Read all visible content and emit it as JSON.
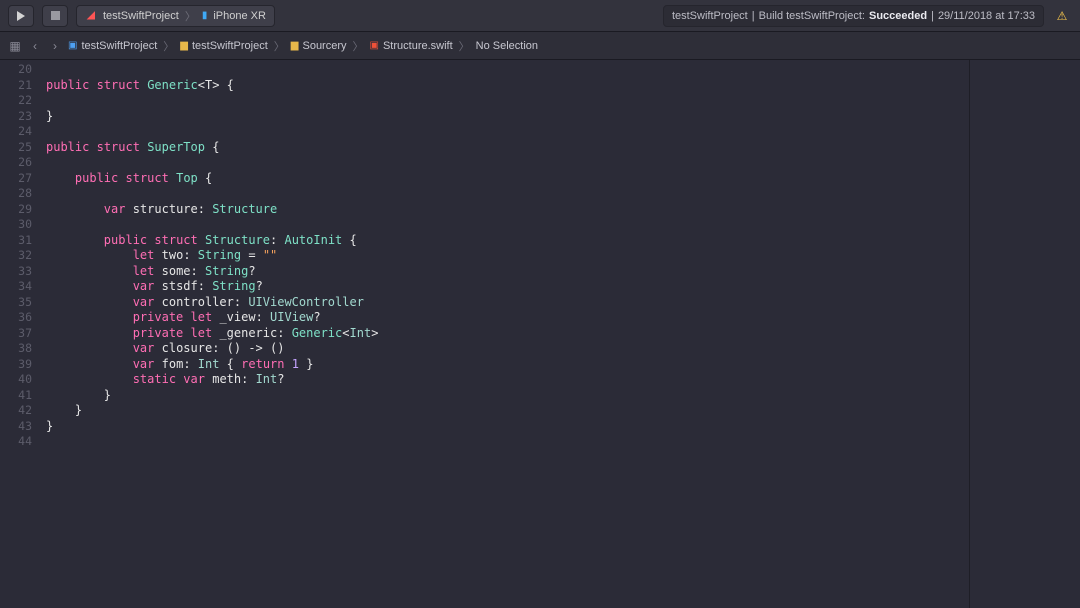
{
  "toolbar": {
    "scheme_project": "testSwiftProject",
    "scheme_device": "iPhone XR"
  },
  "status": {
    "project": "testSwiftProject",
    "action": "Build testSwiftProject:",
    "result": "Succeeded",
    "time": "29/11/2018 at 17:33"
  },
  "jumpbar": {
    "items": [
      "testSwiftProject",
      "testSwiftProject",
      "Sourcery",
      "Structure.swift",
      "No Selection"
    ]
  },
  "gutter": {
    "start": 20,
    "end": 44
  },
  "code": {
    "l20": "",
    "l21_a": "public",
    "l21_b": "struct",
    "l21_c": "Generic",
    "l21_d": "<T> {",
    "l22": "",
    "l23": "}",
    "l24": "",
    "l25_a": "public",
    "l25_b": "struct",
    "l25_c": "SuperTop",
    "l25_d": " {",
    "l26": "",
    "l27_a": "public",
    "l27_b": "struct",
    "l27_c": "Top",
    "l27_d": " {",
    "l28": "",
    "l29_a": "var",
    "l29_b": "structure",
    "l29_c": ": ",
    "l29_d": "Structure",
    "l30": "",
    "l31_a": "public",
    "l31_b": "struct",
    "l31_c": "Structure",
    "l31_d": ": ",
    "l31_e": "AutoInit",
    "l31_f": " {",
    "l32_a": "let",
    "l32_b": "two",
    "l32_c": ": ",
    "l32_d": "String",
    "l32_e": " = ",
    "l32_f": "\"\"",
    "l33_a": "let",
    "l33_b": "some",
    "l33_c": ": ",
    "l33_d": "String",
    "l33_e": "?",
    "l34_a": "var",
    "l34_b": "stsdf",
    "l34_c": ": ",
    "l34_d": "String",
    "l34_e": "?",
    "l35_a": "var",
    "l35_b": "controller",
    "l35_c": ": ",
    "l35_d": "UIViewController",
    "l36_a": "private",
    "l36_b": "let",
    "l36_c": "_view",
    "l36_d": ": ",
    "l36_e": "UIView",
    "l36_f": "?",
    "l37_a": "private",
    "l37_b": "let",
    "l37_c": "_generic",
    "l37_d": ": ",
    "l37_e": "Generic",
    "l37_f": "<",
    "l37_g": "Int",
    "l37_h": ">",
    "l38_a": "var",
    "l38_b": "closure",
    "l38_c": ": () -> ()",
    "l39_a": "var",
    "l39_b": "fom",
    "l39_c": ": ",
    "l39_d": "Int",
    "l39_e": " { ",
    "l39_f": "return",
    "l39_g": " ",
    "l39_h": "1",
    "l39_i": " }",
    "l40_a": "static",
    "l40_b": "var",
    "l40_c": "meth",
    "l40_d": ": ",
    "l40_e": "Int",
    "l40_f": "?",
    "l41": "        }",
    "l42": "    }",
    "l43": "}",
    "l44": ""
  }
}
